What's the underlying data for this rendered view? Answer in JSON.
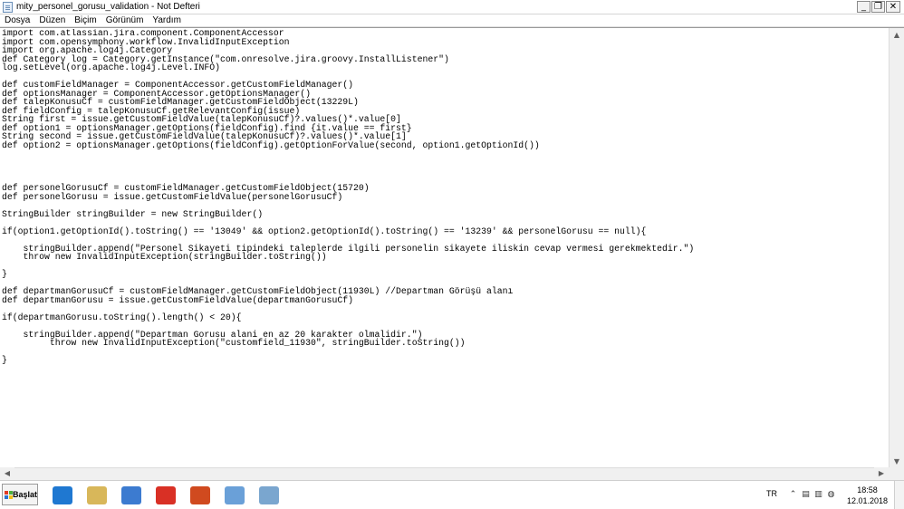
{
  "window": {
    "title": "mity_personel_gorusu_validation - Not Defteri",
    "buttons": {
      "minimize": "_",
      "restore": "❐",
      "close": "✕"
    }
  },
  "menu": [
    "Dosya",
    "Düzen",
    "Biçim",
    "Görünüm",
    "Yardım"
  ],
  "editor": {
    "lines": [
      "import com.atlassian.jira.component.ComponentAccessor",
      "import com.opensymphony.workflow.InvalidInputException",
      "import org.apache.log4j.Category",
      "def Category log = Category.getInstance(\"com.onresolve.jira.groovy.InstallListener\")",
      "log.setLevel(org.apache.log4j.Level.INFO)",
      "",
      "def customFieldManager = ComponentAccessor.getCustomFieldManager()",
      "def optionsManager = ComponentAccessor.getOptionsManager()",
      "def talepKonusuCf = customFieldManager.getCustomFieldObject(13229L)",
      "def fieldConfig = talepKonusuCf.getRelevantConfig(issue)",
      "String first = issue.getCustomFieldValue(talepKonusuCf)?.values()*.value[0]",
      "def option1 = optionsManager.getOptions(fieldConfig).find {it.value == first}",
      "String second = issue.getCustomFieldValue(talepKonusuCf)?.values()*.value[1]",
      "def option2 = optionsManager.getOptions(fieldConfig).getOptionForValue(second, option1.getOptionId())",
      "",
      "",
      "",
      "",
      "def personelGorusuCf = customFieldManager.getCustomFieldObject(15720)",
      "def personelGorusu = issue.getCustomFieldValue(personelGorusuCf)",
      "",
      "StringBuilder stringBuilder = new StringBuilder()",
      "",
      "if(option1.getOptionId().toString() == '13049' && option2.getOptionId().toString() == '13239' && personelGorusu == null){",
      "",
      "    stringBuilder.append(\"Personel Sikayeti tipindeki taleplerde ilgili personelin sikayete iliskin cevap vermesi gerekmektedir.\")",
      "    throw new InvalidInputException(stringBuilder.toString())",
      "",
      "}",
      "",
      "def departmanGorusuCf = customFieldManager.getCustomFieldObject(11930L) //Departman Görüşü alanı",
      "def departmanGorusu = issue.getCustomFieldValue(departmanGorusuCf)",
      "",
      "if(departmanGorusu.toString().length() < 20){",
      "",
      "    stringBuilder.append(\"Departman Gorusu alani en az 20 karakter olmalidir.\")",
      "         throw new InvalidInputException(\"customfield_11930\", stringBuilder.toString())",
      "",
      "}"
    ]
  },
  "taskbar": {
    "start_label": "Başlat",
    "apps": [
      {
        "icon": "internet-explorer-icon",
        "color": "#1f78d1"
      },
      {
        "icon": "file-explorer-icon",
        "color": "#d8b75a"
      },
      {
        "icon": "media-player-icon",
        "color": "#3c7bd0"
      },
      {
        "icon": "chrome-icon",
        "color": "#d93025"
      },
      {
        "icon": "outlook-icon",
        "color": "#d04a1f"
      },
      {
        "icon": "paint-icon",
        "color": "#6aa0d8"
      },
      {
        "icon": "notepad-icon",
        "color": "#7aa6cf"
      }
    ],
    "tray": {
      "language": "TR",
      "time": "18:58",
      "date": "12.01.2018"
    }
  }
}
